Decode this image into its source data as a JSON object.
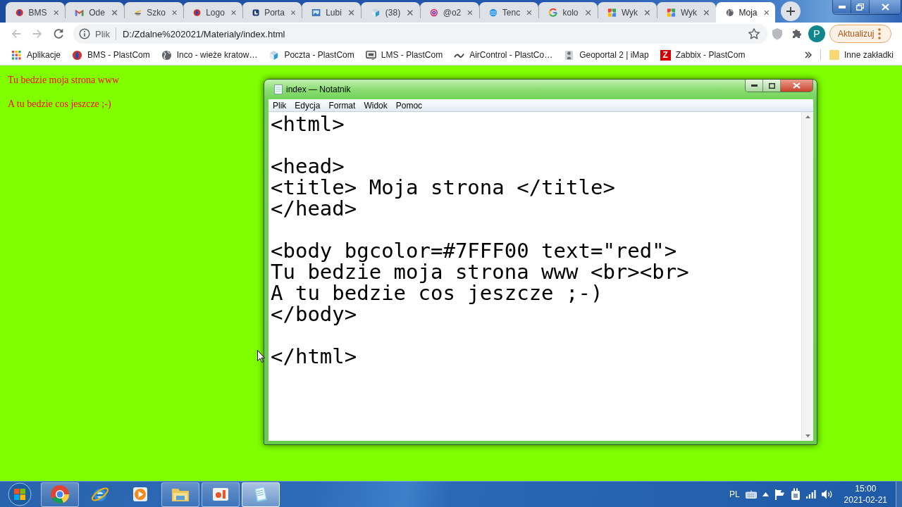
{
  "browser": {
    "tabs": [
      {
        "title": "BMS",
        "selected": false
      },
      {
        "title": "Ode",
        "selected": false
      },
      {
        "title": "Szko",
        "selected": false
      },
      {
        "title": "Logo",
        "selected": false
      },
      {
        "title": "Porta",
        "selected": false
      },
      {
        "title": "Lubi",
        "selected": false
      },
      {
        "title": "(38)",
        "selected": false
      },
      {
        "title": "@o2",
        "selected": false
      },
      {
        "title": "Tenc",
        "selected": false
      },
      {
        "title": "kolo",
        "selected": false
      },
      {
        "title": "Wyk",
        "selected": false
      },
      {
        "title": "Wyk",
        "selected": false
      },
      {
        "title": "Moja",
        "selected": true
      }
    ],
    "toolbar": {
      "back": {
        "disabled": true
      },
      "forward": {
        "disabled": true
      },
      "security_label": "Plik",
      "url": "D:/Zdalne%202021/Materialy/index.html",
      "profile_initial": "P",
      "update_button": "Aktualizuj"
    },
    "bookmarks": [
      {
        "label": "Aplikacje"
      },
      {
        "label": "BMS - PlastCom"
      },
      {
        "label": "Inco - wieże kratow…"
      },
      {
        "label": "Poczta - PlastCom"
      },
      {
        "label": "LMS - PlastCom"
      },
      {
        "label": "AirControl - PlastCo…"
      },
      {
        "label": "Geoportal 2 | iMap"
      },
      {
        "label": "Zabbix - PlastCom",
        "icon_letter": "Z"
      }
    ],
    "other_bookmarks": "Inne zakładki"
  },
  "page": {
    "lines": [
      "Tu bedzie moja strona www",
      "A tu bedzie cos jeszcze ;-)"
    ]
  },
  "notepad": {
    "title": "index — Notatnik",
    "menu": [
      "Plik",
      "Edycja",
      "Format",
      "Widok",
      "Pomoc"
    ],
    "content": "<html>\n\n<head>\n<title> Moja strona </title>\n</head>\n\n<body bgcolor=#7FFF00 text=\"red\">\nTu bedzie moja strona www <br><br>\nA tu bedzie cos jeszcze ;-)\n</body>\n\n</html>"
  },
  "taskbar": {
    "apps": [
      {
        "open": true,
        "selected": false
      },
      {
        "open": false,
        "selected": false
      },
      {
        "open": false,
        "selected": false
      },
      {
        "open": true,
        "selected": false
      },
      {
        "open": true,
        "selected": false
      },
      {
        "open": true,
        "selected": true
      }
    ],
    "language": "PL",
    "time": "15:00",
    "date": "2021-02-21"
  }
}
